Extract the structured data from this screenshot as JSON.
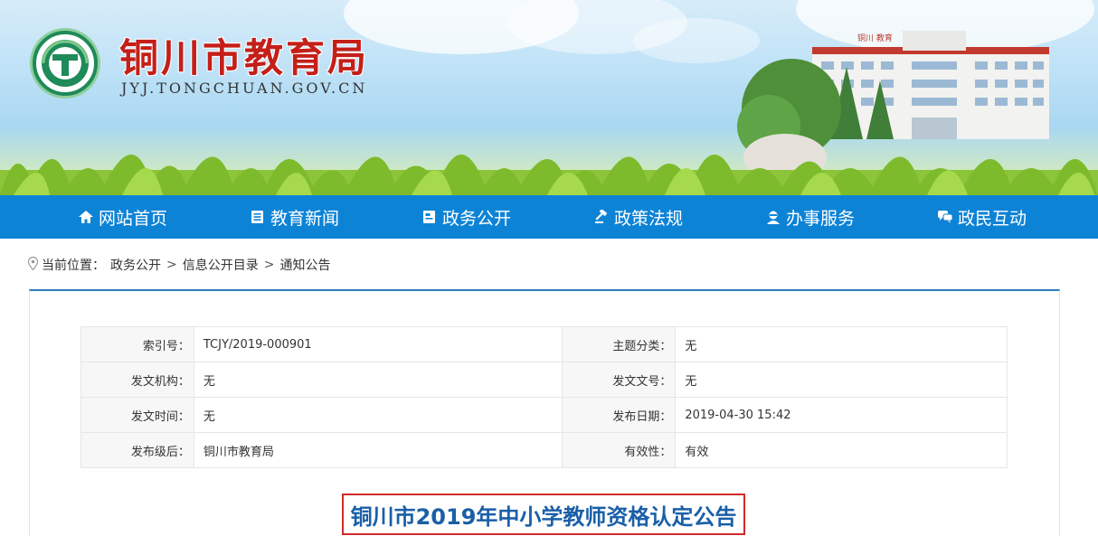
{
  "header": {
    "site_title": "铜川市教育局",
    "site_domain": "JYJ.TONGCHUAN.GOV.CN",
    "building_sign": "铜川            教育"
  },
  "nav": {
    "items": [
      {
        "label": "网站首页",
        "icon": "home-icon"
      },
      {
        "label": "教育新闻",
        "icon": "document-list-icon"
      },
      {
        "label": "政务公开",
        "icon": "book-icon"
      },
      {
        "label": "政策法规",
        "icon": "gavel-icon"
      },
      {
        "label": "办事服务",
        "icon": "service-person-icon"
      },
      {
        "label": "政民互动",
        "icon": "chat-bubbles-icon"
      }
    ]
  },
  "breadcrumb": {
    "prefix": "当前位置：",
    "items": [
      "政务公开",
      "信息公开目录",
      "通知公告"
    ],
    "separator": ">"
  },
  "meta": {
    "rows": [
      {
        "l1": "索引号：",
        "v1": "TCJY/2019-000901",
        "l2": "主题分类：",
        "v2": "无"
      },
      {
        "l1": "发文机构：",
        "v1": "无",
        "l2": "发文文号：",
        "v2": "无"
      },
      {
        "l1": "发文时间：",
        "v1": "无",
        "l2": "发布日期：",
        "v2": "2019-04-30 15:42"
      },
      {
        "l1": "发布级后：",
        "v1": "铜川市教育局",
        "l2": "有效性：",
        "v2": "有效"
      }
    ]
  },
  "article": {
    "title": "铜川市2019年中小学教师资格认定公告"
  },
  "colors": {
    "nav_bg": "#0d83d6",
    "title_red": "#c41f19",
    "article_title_blue": "#1a5fa8",
    "title_border_red": "#d02a2a"
  }
}
